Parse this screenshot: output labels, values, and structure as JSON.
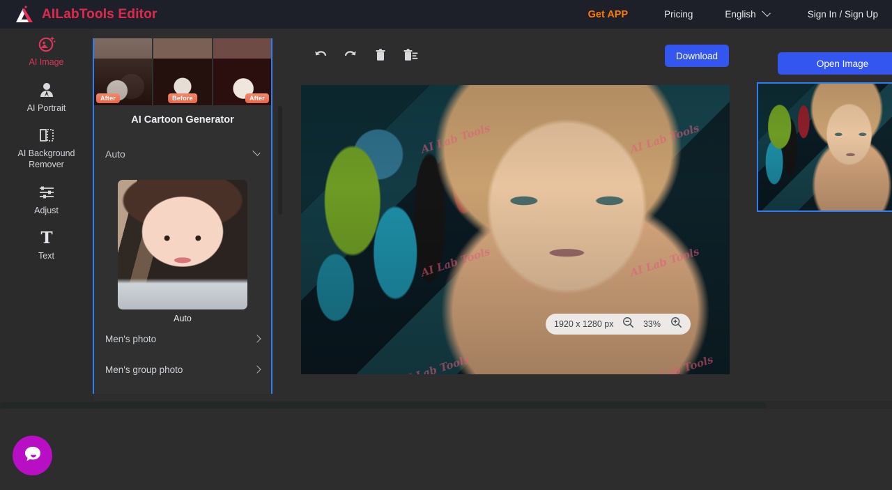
{
  "header": {
    "brand_title": "AILabTools Editor",
    "logo_icon": "ailab-logo-icon",
    "nav": {
      "get_app": "Get APP",
      "pricing": "Pricing",
      "language": "English",
      "language_chevron_icon": "chevron-down-icon",
      "sign_in": "Sign In / Sign Up"
    }
  },
  "sidebar": {
    "items": [
      {
        "label": "AI Image",
        "icon": "ai-image-icon",
        "active": true
      },
      {
        "label": "AI Portrait",
        "icon": "portrait-icon",
        "active": false
      },
      {
        "label": "AI Background Remover",
        "icon": "background-remover-icon",
        "active": false
      },
      {
        "label": "Adjust",
        "icon": "sliders-icon",
        "active": false
      },
      {
        "label": "Text",
        "icon": "text-icon",
        "active": false
      }
    ]
  },
  "panel": {
    "title": "AI Cartoon Generator",
    "thumbnails": [
      {
        "badge": "After",
        "badge_pos": "left"
      },
      {
        "badge": "Before",
        "badge_pos": "mid"
      },
      {
        "badge": "After",
        "badge_pos": "right"
      }
    ],
    "style_select": {
      "value": "Auto",
      "chevron_icon": "chevron-down-icon"
    },
    "preview": {
      "label": "Auto"
    },
    "categories": [
      {
        "label": "Men's photo",
        "chevron_icon": "chevron-right-icon"
      },
      {
        "label": "Men's group photo",
        "chevron_icon": "chevron-right-icon"
      }
    ]
  },
  "toolbar": {
    "buttons": [
      {
        "name": "undo-button",
        "icon": "undo-icon"
      },
      {
        "name": "redo-button",
        "icon": "redo-icon"
      },
      {
        "name": "delete-button",
        "icon": "trash-icon"
      },
      {
        "name": "delete-all-button",
        "icon": "trash-all-icon"
      }
    ],
    "download_label": "Download",
    "open_image_label": "Open Image"
  },
  "canvas": {
    "watermark_text": "AI Lab Tools",
    "zoom_bar": {
      "dimensions": "1920 x 1280 px",
      "zoom_out_icon": "zoom-out-icon",
      "zoom_level": "33%",
      "zoom_in_icon": "zoom-in-icon"
    }
  },
  "layers": {
    "selected_thumbnail": "layer-thumbnail-1"
  },
  "chat": {
    "fab_icon": "chat-bubble-icon"
  },
  "colors": {
    "header_bg": "#1e2029",
    "brand": "#d62a4f",
    "accent_orange": "#ff7a00",
    "accent_blue": "#3355f0",
    "panel_border_blue": "#2f7df4",
    "chat_magenta": "#b80fc4",
    "app_bg": "#2d2d2d"
  }
}
